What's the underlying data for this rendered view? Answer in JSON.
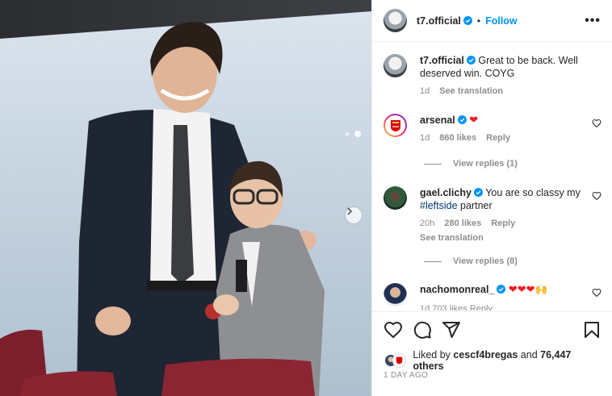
{
  "post": {
    "author": "t7.official",
    "separator": "•",
    "follow_label": "Follow",
    "more_label": "•••"
  },
  "comments": [
    {
      "username": "t7.official",
      "text": "Great to be back. Well deserved win. COYG",
      "age": "1d",
      "see_translation": "See translation",
      "verified": true
    },
    {
      "username": "arsenal",
      "text": "❤",
      "age": "1d",
      "likes": "860 likes",
      "reply": "Reply",
      "view_replies": "View replies (1)",
      "verified": true
    },
    {
      "username": "gael.clichy",
      "text_before": "You are so classy my ",
      "hashtag": "#leftside",
      "text_after": " partner",
      "age": "20h",
      "likes": "280 likes",
      "reply": "Reply",
      "see_translation": "See translation",
      "view_replies": "View replies (8)",
      "verified": true
    },
    {
      "username": "nachomonreal_",
      "emojis": "❤❤❤",
      "emoji_extra": "🙌",
      "partial_meta": "1d   703 likes   Reply",
      "verified": true
    }
  ],
  "likes": {
    "prefix": "Liked by ",
    "user": "cescf4bregas",
    "middle": " and ",
    "count": "76,447 others"
  },
  "timestamp": "1 DAY AGO",
  "colors": {
    "accent": "#0095f6",
    "verified": "#0095f6",
    "heart": "#ed1c24",
    "muted": "#8e8e8e"
  },
  "icons": [
    "heart-icon",
    "comment-icon",
    "share-icon",
    "bookmark-icon",
    "verified-icon",
    "chevron-right-icon",
    "more-icon"
  ]
}
